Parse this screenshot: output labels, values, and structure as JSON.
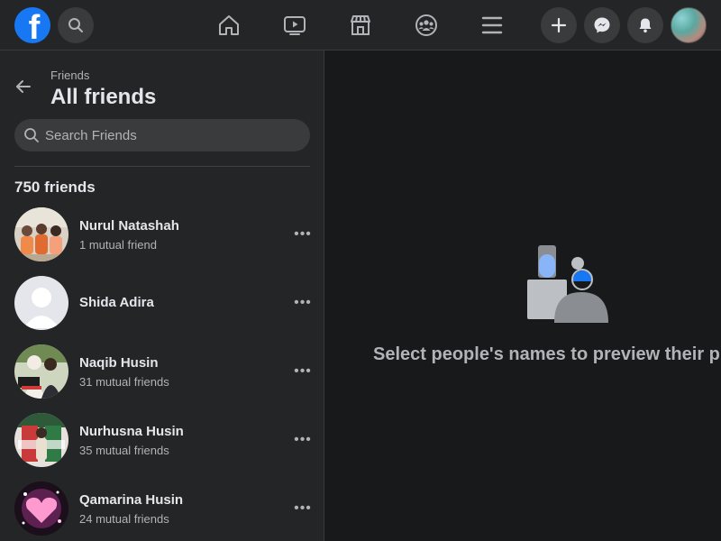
{
  "topbar": {
    "logo_letter": "f",
    "nav": [
      "home-icon",
      "watch-icon",
      "marketplace-icon",
      "groups-icon",
      "menu-icon"
    ],
    "actions": [
      "create-icon",
      "messenger-icon",
      "notifications-icon"
    ]
  },
  "sidebar": {
    "breadcrumb": "Friends",
    "title": "All friends",
    "search_placeholder": "Search Friends",
    "friend_count": "750 friends",
    "friends": [
      {
        "name": "Nurul Natashah",
        "mutual": "1 mutual friend"
      },
      {
        "name": "Shida Adira",
        "mutual": ""
      },
      {
        "name": "Naqib Husin",
        "mutual": "31 mutual friends"
      },
      {
        "name": "Nurhusna Husin",
        "mutual": "35 mutual friends"
      },
      {
        "name": "Qamarina Husin",
        "mutual": "24 mutual friends"
      }
    ],
    "more_label": "•••"
  },
  "main": {
    "preview_text": "Select people's names to preview their pr"
  },
  "colors": {
    "accent": "#1877f2",
    "surface": "#242526",
    "background": "#18191a"
  }
}
